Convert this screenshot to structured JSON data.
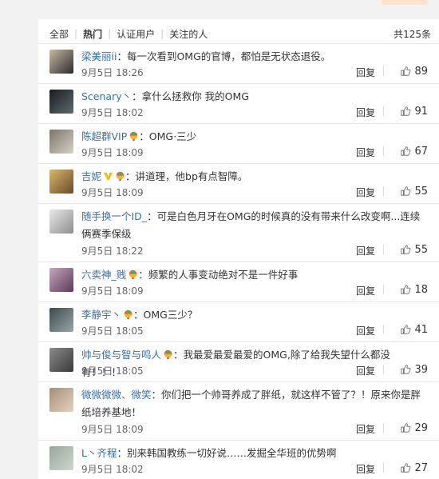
{
  "filters": {
    "tabs": [
      "全部",
      "热门",
      "认证用户",
      "关注的人"
    ],
    "active": "热门",
    "total_label": "共125条"
  },
  "reply_label": "回复",
  "colors": {
    "username": "#3c6ea6",
    "accent": "#fb7e2b",
    "background": "#f2f2f2"
  },
  "comments": [
    {
      "user": "梁美丽ii",
      "sep": "：",
      "text": "每一次看到OMG的官博，都怕是无状态退役。",
      "time": "9月5日 18:26",
      "likes": "89",
      "badges": []
    },
    {
      "user": "Scenary丶",
      "sep": "：",
      "text": "拿什么拯救你 我的OMG",
      "time": "9月5日 18:02",
      "likes": "91",
      "badges": []
    },
    {
      "user": "陈超群VIP",
      "sep": "：",
      "text": "OMG·三少",
      "time": "9月5日 18:09",
      "likes": "67",
      "badges": [
        "balloon"
      ]
    },
    {
      "user": "吉妮",
      "sep": "：",
      "text": "讲道理，他bp有点智障。",
      "time": "9月5日 18:09",
      "likes": "55",
      "badges": [
        "v",
        "balloon"
      ]
    },
    {
      "user": "随手换一个ID_",
      "sep": "：",
      "text": "可是白色月牙在OMG的时候真的没有带来什么改变啊...连续俩赛季保级",
      "time": "9月5日 18:22",
      "likes": "55",
      "badges": []
    },
    {
      "user": "六卖神_贱",
      "sep": "：",
      "text": "频繁的人事变动绝对不是一件好事",
      "time": "9月5日 18:09",
      "likes": "18",
      "badges": [
        "balloon"
      ]
    },
    {
      "user": "李静宇丶",
      "sep": "：",
      "text": "OMG三少？",
      "time": "9月5日 18:05",
      "likes": "41",
      "badges": [
        "balloon"
      ]
    },
    {
      "user": "帅与俊与智与鸣人",
      "sep": "：",
      "text": "我最爱最爱最爱的OMG,除了给我失望什么都没有！！！",
      "time": "9月5日 18:05",
      "likes": "39",
      "badges": [
        "balloon"
      ]
    },
    {
      "user": "微微微微、微笑",
      "sep": "：",
      "text": "你们把一个帅哥养成了胖纸，就这样不管了？！原来你是胖纸培养基地！",
      "time": "9月5日 18:09",
      "likes": "29",
      "badges": []
    },
    {
      "user": "L丶齐程",
      "sep": "：",
      "text": "别来韩国教练一切好说……发掘全华班的优势啊",
      "time": "9月5日 18:02",
      "likes": "27",
      "badges": []
    }
  ]
}
